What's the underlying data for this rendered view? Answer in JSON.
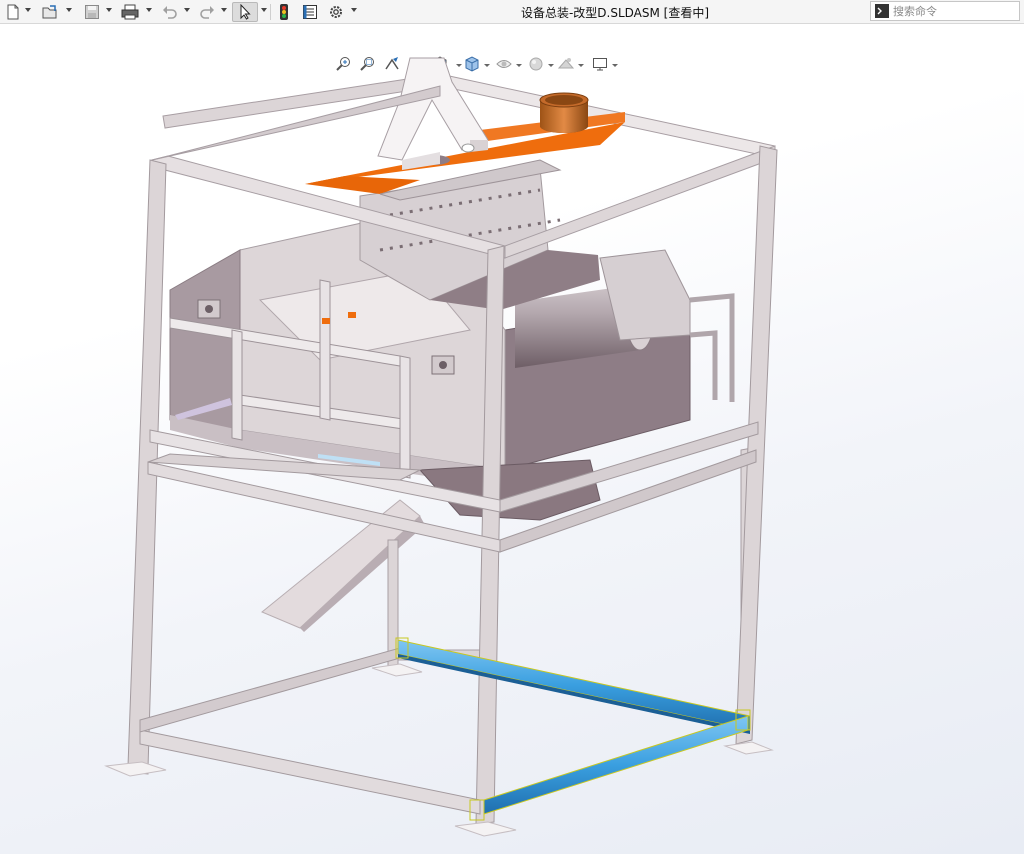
{
  "window": {
    "title": "设备总装-改型D.SLDASM [查看中]"
  },
  "toolbar": {
    "icons": [
      "new-document-icon",
      "open-folder-icon",
      "save-icon",
      "print-icon",
      "undo-icon",
      "redo-icon",
      "select-arrow-icon",
      "rebuild-traffic-light-icon",
      "file-properties-icon",
      "options-gear-icon"
    ]
  },
  "search": {
    "placeholder": "搜索命令"
  },
  "view_toolbar": {
    "icons": [
      "zoom-to-fit-icon",
      "zoom-to-area-icon",
      "previous-view-icon",
      "section-view-icon",
      "view-orientation-icon",
      "display-style-icon",
      "hide-show-items-icon",
      "edit-appearance-icon",
      "apply-scene-icon",
      "view-settings-icon"
    ]
  },
  "colors": {
    "frame": "#d9d3d3",
    "frame_shadow": "#a79ea3",
    "hopper": "#8d7b84",
    "orange_plate": "#ef6d0d",
    "selected_beam": "#3da4e6",
    "selection_outline": "#c8c820",
    "roller": "#8f7e85"
  }
}
